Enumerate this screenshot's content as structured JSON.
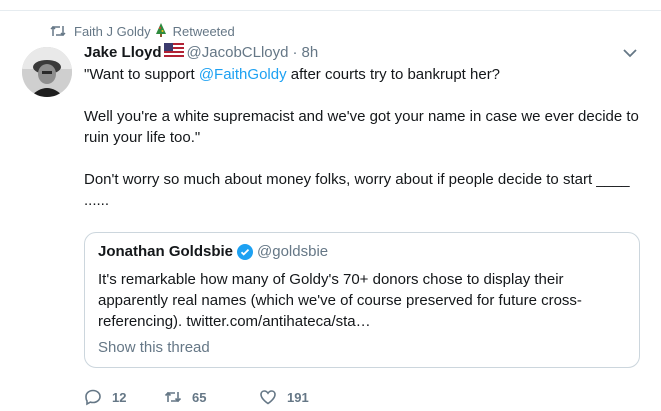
{
  "retweet_line": {
    "user": "Faith J Goldy",
    "label": "Retweeted"
  },
  "tweet": {
    "author_name": "Jake Lloyd",
    "handle": "@JacobCLloyd",
    "separator": "·",
    "time": "8h",
    "text": {
      "line1_prefix": "\"Want to support ",
      "line1_mention": "@FaithGoldy",
      "line1_suffix": " after courts try to bankrupt her?",
      "para2": "Well you're a white supremacist and we've got your name in case we ever decide to ruin your life too.\"",
      "para3": "Don't worry so much about money folks, worry about if people decide to start ____ ......"
    }
  },
  "quoted_tweet": {
    "author_name": "Jonathan Goldsbie",
    "handle": "@goldsbie",
    "text": "It's remarkable how many of Goldy's 70+ donors chose to display their apparently real names (which we've of course preserved for future cross-referencing). twitter.com/antihateca/sta…",
    "show_thread": "Show this thread"
  },
  "actions": {
    "replies": "12",
    "retweets": "65",
    "likes": "191"
  },
  "colors": {
    "link": "#1da1f2",
    "muted": "#657786",
    "border": "#ccd6dd",
    "text": "#14171a"
  }
}
